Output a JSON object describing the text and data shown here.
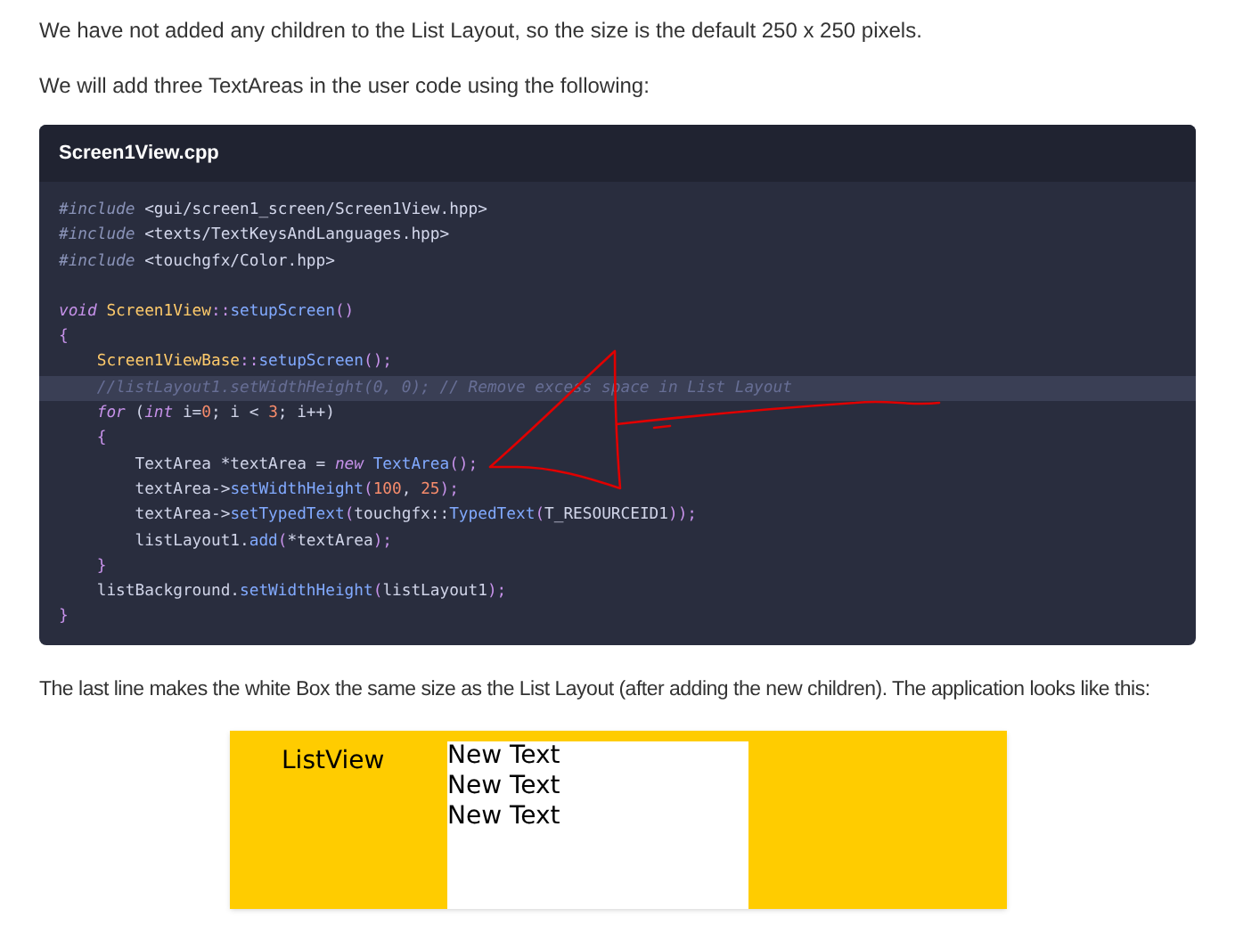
{
  "intro": "We have not added any children to the List Layout, so the size is the default 250 x 250 pixels.",
  "lead": "We will add three TextAreas in the user code using the following:",
  "code": {
    "filename": "Screen1View.cpp",
    "sections": [
      {
        "lines": [
          {
            "highlighted": false,
            "tokens": [
              {
                "kind": "directive",
                "text": "#include"
              },
              {
                "kind": "string",
                "text": " <gui/screen1_screen/Screen1View.hpp>"
              }
            ]
          },
          {
            "highlighted": false,
            "tokens": [
              {
                "kind": "directive",
                "text": "#include"
              },
              {
                "kind": "string",
                "text": " <texts/TextKeysAndLanguages.hpp>"
              }
            ]
          },
          {
            "highlighted": false,
            "tokens": [
              {
                "kind": "directive",
                "text": "#include"
              },
              {
                "kind": "string",
                "text": " <touchgfx/Color.hpp>"
              }
            ]
          }
        ]
      },
      {
        "lines": [
          {
            "highlighted": false,
            "tokens": [
              {
                "kind": "keyword",
                "text": "void"
              },
              {
                "kind": "type",
                "text": " Screen1View"
              },
              {
                "kind": "punct",
                "text": "::"
              },
              {
                "kind": "func",
                "text": "setupScreen"
              },
              {
                "kind": "punct",
                "text": "()"
              }
            ]
          },
          {
            "highlighted": false,
            "tokens": [
              {
                "kind": "punct",
                "text": "{"
              }
            ]
          },
          {
            "highlighted": false,
            "tokens": [
              {
                "kind": "type",
                "text": "    Screen1ViewBase"
              },
              {
                "kind": "punct",
                "text": "::"
              },
              {
                "kind": "func",
                "text": "setupScreen"
              },
              {
                "kind": "punct",
                "text": "();"
              }
            ]
          },
          {
            "highlighted": true,
            "tokens": [
              {
                "kind": "comment",
                "text": "    //listLayout1.setWidthHeight(0, 0); // Remove excess space in List Layout"
              }
            ]
          },
          {
            "highlighted": false,
            "tokens": [
              {
                "kind": "keyword",
                "text": "    for"
              },
              {
                "kind": "plain",
                "text": " ("
              },
              {
                "kind": "keyword",
                "text": "int"
              },
              {
                "kind": "plain",
                "text": " i="
              },
              {
                "kind": "number",
                "text": "0"
              },
              {
                "kind": "plain",
                "text": "; i < "
              },
              {
                "kind": "number",
                "text": "3"
              },
              {
                "kind": "plain",
                "text": "; i++)"
              }
            ]
          },
          {
            "highlighted": false,
            "tokens": [
              {
                "kind": "punct",
                "text": "    {"
              }
            ]
          },
          {
            "highlighted": false,
            "tokens": [
              {
                "kind": "plain",
                "text": "        TextArea *textArea = "
              },
              {
                "kind": "keyword",
                "text": "new"
              },
              {
                "kind": "func",
                "text": " TextArea"
              },
              {
                "kind": "punct",
                "text": "();"
              }
            ]
          },
          {
            "highlighted": false,
            "tokens": [
              {
                "kind": "plain",
                "text": "        textArea->"
              },
              {
                "kind": "func",
                "text": "setWidthHeight"
              },
              {
                "kind": "punct",
                "text": "("
              },
              {
                "kind": "number",
                "text": "100"
              },
              {
                "kind": "plain",
                "text": ", "
              },
              {
                "kind": "number",
                "text": "25"
              },
              {
                "kind": "punct",
                "text": ");"
              }
            ]
          },
          {
            "highlighted": false,
            "tokens": [
              {
                "kind": "plain",
                "text": "        textArea->"
              },
              {
                "kind": "func",
                "text": "setTypedText"
              },
              {
                "kind": "punct",
                "text": "("
              },
              {
                "kind": "plain",
                "text": "touchgfx::"
              },
              {
                "kind": "func",
                "text": "TypedText"
              },
              {
                "kind": "punct",
                "text": "("
              },
              {
                "kind": "plain",
                "text": "T_RESOURCEID1"
              },
              {
                "kind": "punct",
                "text": "));"
              }
            ]
          },
          {
            "highlighted": false,
            "tokens": [
              {
                "kind": "plain",
                "text": "        listLayout1."
              },
              {
                "kind": "func",
                "text": "add"
              },
              {
                "kind": "punct",
                "text": "("
              },
              {
                "kind": "plain",
                "text": "*textArea"
              },
              {
                "kind": "punct",
                "text": ");"
              }
            ]
          },
          {
            "highlighted": false,
            "tokens": [
              {
                "kind": "punct",
                "text": "    }"
              }
            ]
          },
          {
            "highlighted": false,
            "tokens": [
              {
                "kind": "plain",
                "text": "    listBackground."
              },
              {
                "kind": "func",
                "text": "setWidthHeight"
              },
              {
                "kind": "punct",
                "text": "("
              },
              {
                "kind": "plain",
                "text": "listLayout1"
              },
              {
                "kind": "punct",
                "text": ");"
              }
            ]
          },
          {
            "highlighted": false,
            "tokens": [
              {
                "kind": "punct",
                "text": "}"
              }
            ]
          }
        ]
      }
    ]
  },
  "after": "The last line makes the white Box the same size as the List Layout (after adding the new children). The application looks like this:",
  "app": {
    "title": "ListView",
    "items": [
      "New Text",
      "New Text",
      "New Text"
    ]
  }
}
